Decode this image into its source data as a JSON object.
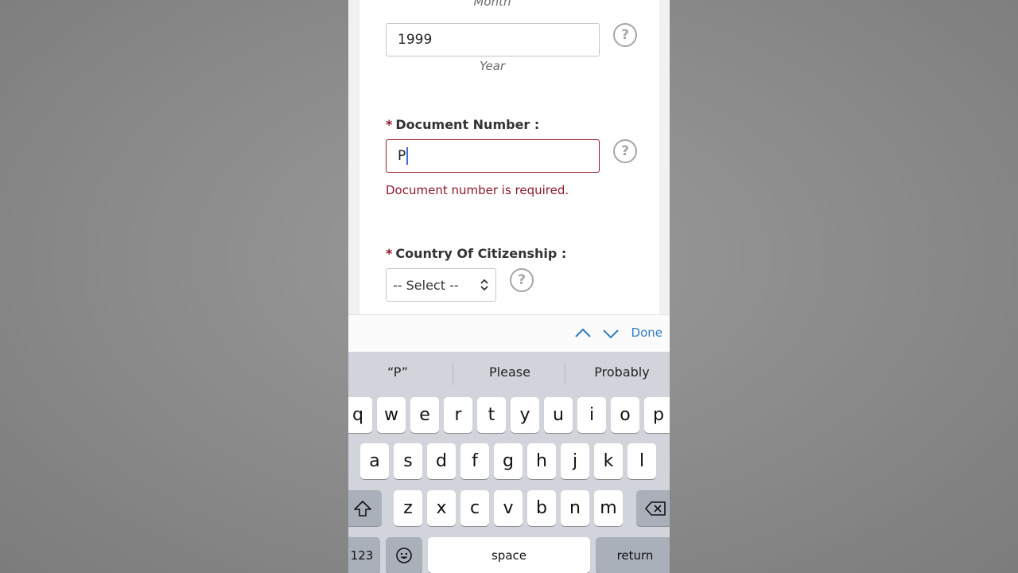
{
  "form": {
    "month_caption": "Month",
    "year_value": "1999",
    "year_caption": "Year",
    "document_number": {
      "required_mark": "*",
      "label": "Document Number :",
      "value": "P",
      "error": "Document number is required."
    },
    "country": {
      "required_mark": "*",
      "label": "Country Of Citizenship :",
      "selected": "-- Select --"
    },
    "help_glyph": "?"
  },
  "toolbar": {
    "done_label": "Done",
    "prev_icon": "chevron-up-icon",
    "next_icon": "chevron-down-icon"
  },
  "keyboard": {
    "suggestions": [
      "“P”",
      "Please",
      "Probably"
    ],
    "rows": [
      [
        "q",
        "w",
        "e",
        "r",
        "t",
        "y",
        "u",
        "i",
        "o",
        "p"
      ],
      [
        "a",
        "s",
        "d",
        "f",
        "g",
        "h",
        "j",
        "k",
        "l"
      ],
      [
        "z",
        "x",
        "c",
        "v",
        "b",
        "n",
        "m"
      ]
    ],
    "numbers_label": "123",
    "space_label": "space",
    "return_label": "return",
    "shift_icon": "shift-icon",
    "delete_icon": "backspace-icon",
    "emoji_icon": "emoji-icon"
  },
  "colors": {
    "error": "#8b1a2b",
    "link": "#2f7cc2",
    "keyboard_bg": "#d1d4da"
  }
}
